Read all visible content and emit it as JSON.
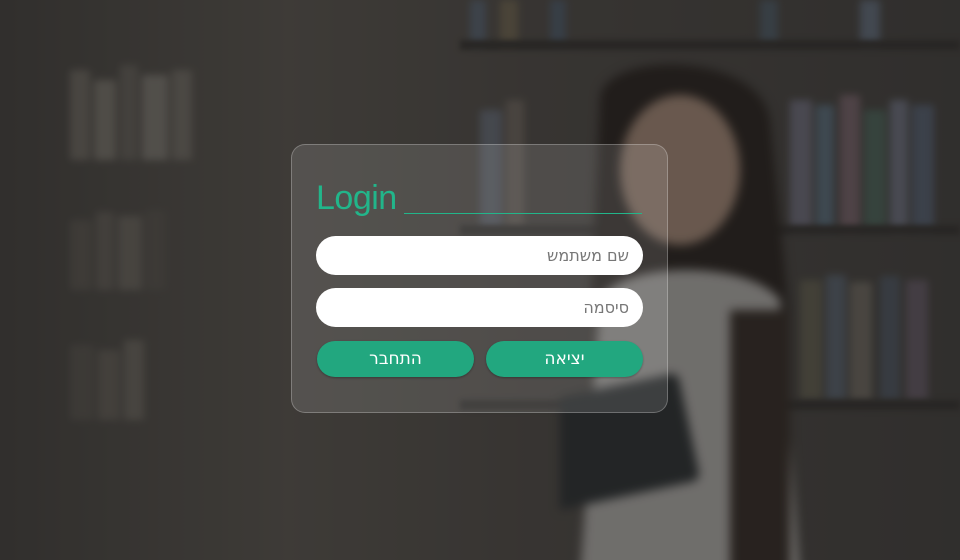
{
  "login": {
    "title": "Login",
    "username_placeholder": "שם משתמש",
    "password_placeholder": "סיסמה",
    "connect_label": "התחבר",
    "exit_label": "יציאה"
  },
  "colors": {
    "accent": "#22b58a",
    "button": "#22a77f",
    "overlay": "#191919"
  }
}
